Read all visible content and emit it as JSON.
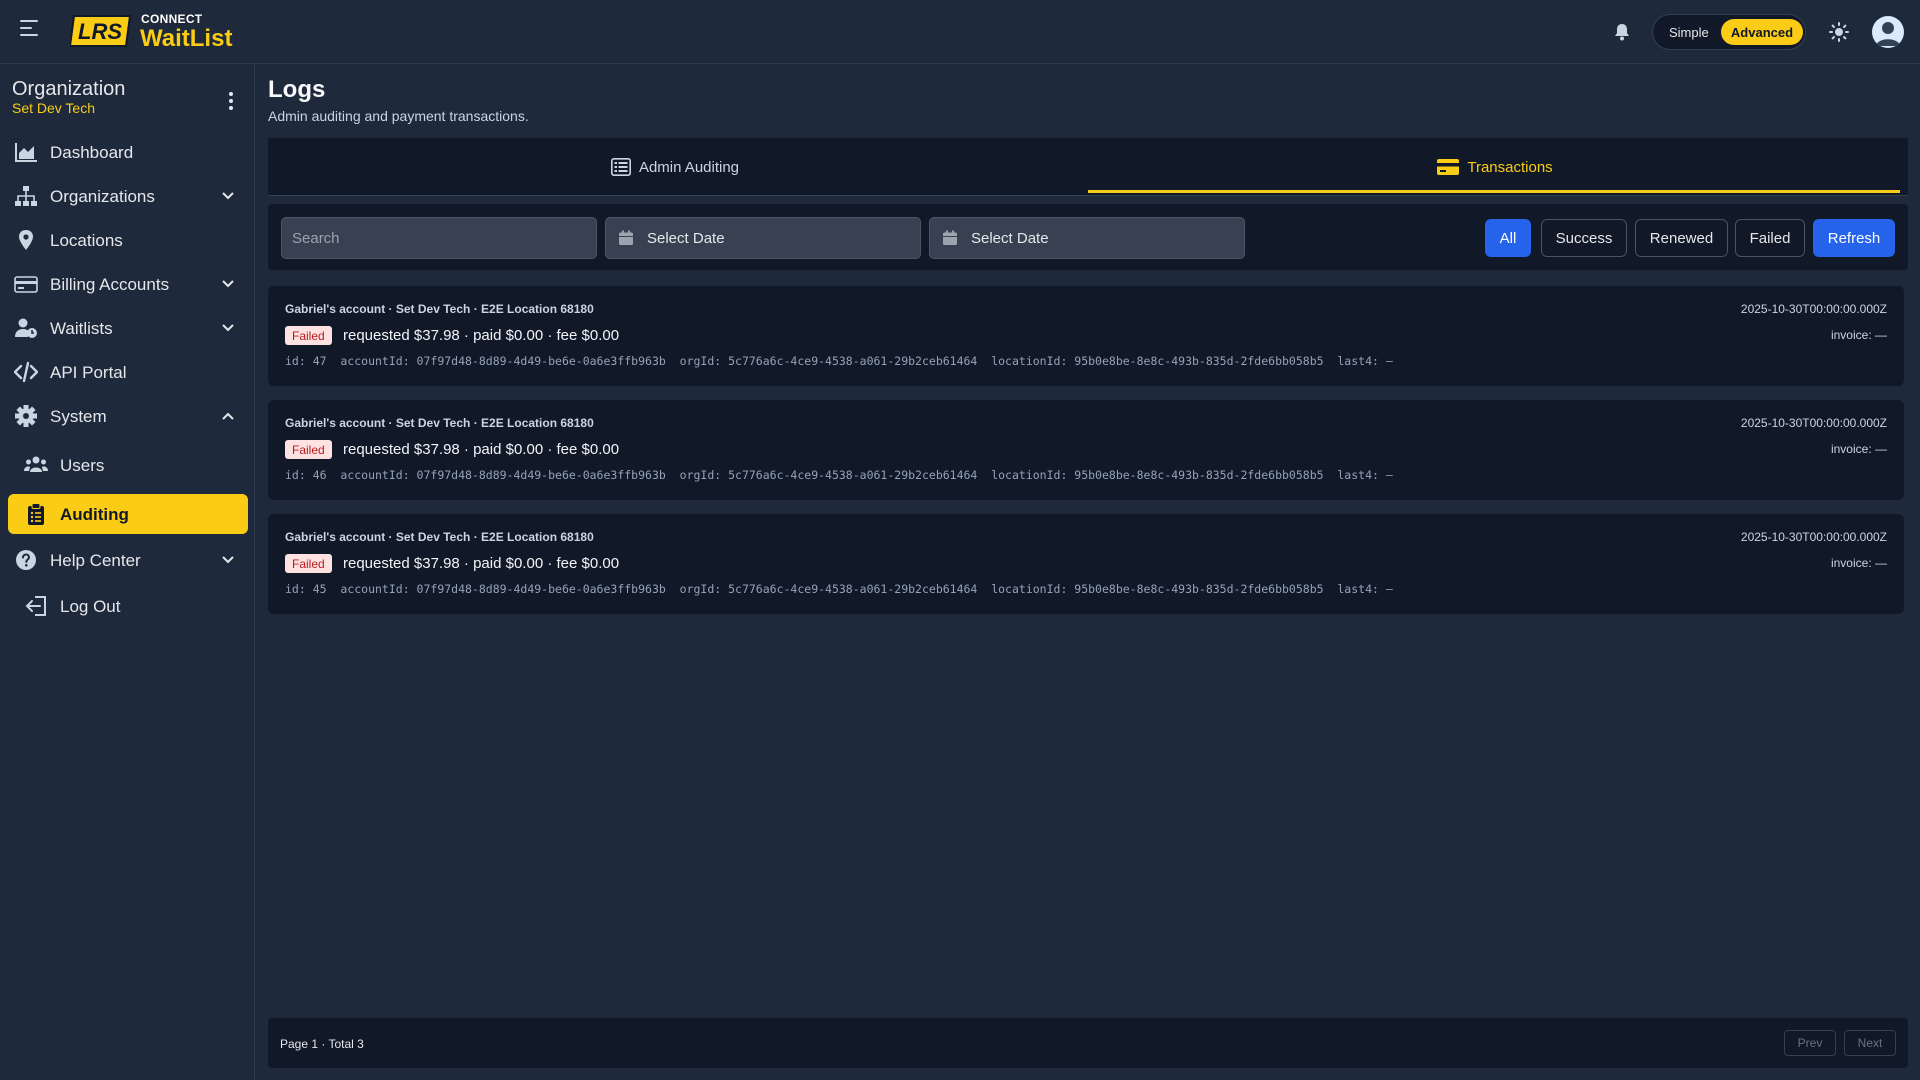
{
  "header": {
    "logo_badge": "LRS",
    "logo_connect": "CONNECT",
    "logo_waitlist": "WaitList",
    "mode_simple": "Simple",
    "mode_advanced": "Advanced",
    "accent_color": "#facc15"
  },
  "sidebar": {
    "org_title": "Organization",
    "org_name": "Set Dev Tech",
    "items": [
      {
        "label": "Dashboard",
        "icon": "chart-area-icon"
      },
      {
        "label": "Organizations",
        "icon": "sitemap-icon"
      },
      {
        "label": "Locations",
        "icon": "map-pin-icon"
      },
      {
        "label": "Billing Accounts",
        "icon": "credit-card-icon"
      },
      {
        "label": "Waitlists",
        "icon": "user-clock-icon"
      },
      {
        "label": "API Portal",
        "icon": "code-icon"
      },
      {
        "label": "System",
        "icon": "gear-icon"
      },
      {
        "label": "Users",
        "icon": "users-icon"
      },
      {
        "label": "Auditing",
        "icon": "clipboard-list-icon",
        "active": true
      },
      {
        "label": "Help Center",
        "icon": "question-circle-icon"
      },
      {
        "label": "Log Out",
        "icon": "logout-icon"
      }
    ]
  },
  "main": {
    "title": "Logs",
    "subtitle": "Admin auditing and payment transactions.",
    "tabs": [
      {
        "label": "Admin Auditing",
        "icon": "table-list-icon"
      },
      {
        "label": "Transactions",
        "icon": "credit-card-icon",
        "active": true
      }
    ],
    "filters": {
      "search_placeholder": "Search",
      "date_from": "Select Date",
      "date_to": "Select Date",
      "buttons": [
        "All",
        "Success",
        "Renewed",
        "Failed"
      ],
      "active_filter": "All",
      "refresh": "Refresh"
    },
    "transactions": [
      {
        "heading": "Gabriel's account · Set Dev Tech · E2E Location 68180",
        "timestamp": "2025-10-30T00:00:00.000Z",
        "status": "Failed",
        "summary": "requested $37.98 · paid $0.00 · fee $0.00",
        "invoice": "invoice: —",
        "ids": "id: 47  accountId: 07f97d48-8d89-4d49-be6e-0a6e3ffb963b  orgId: 5c776a6c-4ce9-4538-a061-29b2ceb61464  locationId: 95b0e8be-8e8c-493b-835d-2fde6bb058b5  last4: —"
      },
      {
        "heading": "Gabriel's account · Set Dev Tech · E2E Location 68180",
        "timestamp": "2025-10-30T00:00:00.000Z",
        "status": "Failed",
        "summary": "requested $37.98 · paid $0.00 · fee $0.00",
        "invoice": "invoice: —",
        "ids": "id: 46  accountId: 07f97d48-8d89-4d49-be6e-0a6e3ffb963b  orgId: 5c776a6c-4ce9-4538-a061-29b2ceb61464  locationId: 95b0e8be-8e8c-493b-835d-2fde6bb058b5  last4: —"
      },
      {
        "heading": "Gabriel's account · Set Dev Tech · E2E Location 68180",
        "timestamp": "2025-10-30T00:00:00.000Z",
        "status": "Failed",
        "summary": "requested $37.98 · paid $0.00 · fee $0.00",
        "invoice": "invoice: —",
        "ids": "id: 45  accountId: 07f97d48-8d89-4d49-be6e-0a6e3ffb963b  orgId: 5c776a6c-4ce9-4538-a061-29b2ceb61464  locationId: 95b0e8be-8e8c-493b-835d-2fde6bb058b5  last4: —"
      }
    ],
    "pagination": {
      "text": "Page 1 · Total 3",
      "prev": "Prev",
      "next": "Next"
    }
  }
}
